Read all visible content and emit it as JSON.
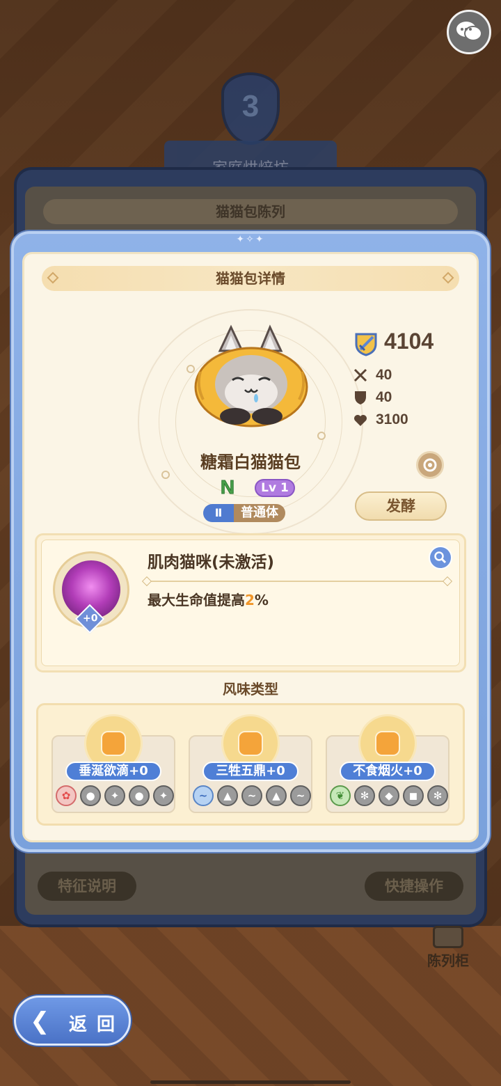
{
  "background": {
    "level_number": "3",
    "ribbon_text": "家庭烘焙坊",
    "panel_title": "猫猫包陈列",
    "feature_button": "特征说明",
    "quick_button": "快捷操作",
    "shelf_label": "陈列柜"
  },
  "modal": {
    "title": "猫猫包详情",
    "deco": "✦✧✦"
  },
  "character": {
    "name": "糖霜白猫猫包",
    "rarity": "N",
    "level": "Lv 1",
    "type_roman": "Ⅱ",
    "type_label": "普通体",
    "power": "4104",
    "attack": "40",
    "defense": "40",
    "hp": "3100",
    "ferment_button": "发酵"
  },
  "skill": {
    "name": "肌肉猫咪(未激活)",
    "desc_prefix": "最大生命值提高",
    "desc_value": "2",
    "desc_suffix": "%",
    "badge": "+0"
  },
  "flavor_section": {
    "title": "风味类型",
    "items": [
      {
        "label": "垂涎欲滴+0"
      },
      {
        "label": "三牲五鼎+0"
      },
      {
        "label": "不食烟火+0"
      }
    ]
  },
  "nav": {
    "back_label": "返回",
    "back_arrow": "❮"
  },
  "colors": {
    "accent_blue": "#4f7fd6",
    "highlight_orange": "#f0962a",
    "rarity_green": "#49a04a",
    "level_purple": "#b07be0"
  },
  "icons": {
    "chat": "chat-bubbles-icon",
    "power": "shield-sword-icon",
    "attack": "crossed-swords-icon",
    "defense": "shield-icon",
    "hp": "heart-icon",
    "swap": "swap-icon",
    "zoom": "magnifier-icon"
  }
}
